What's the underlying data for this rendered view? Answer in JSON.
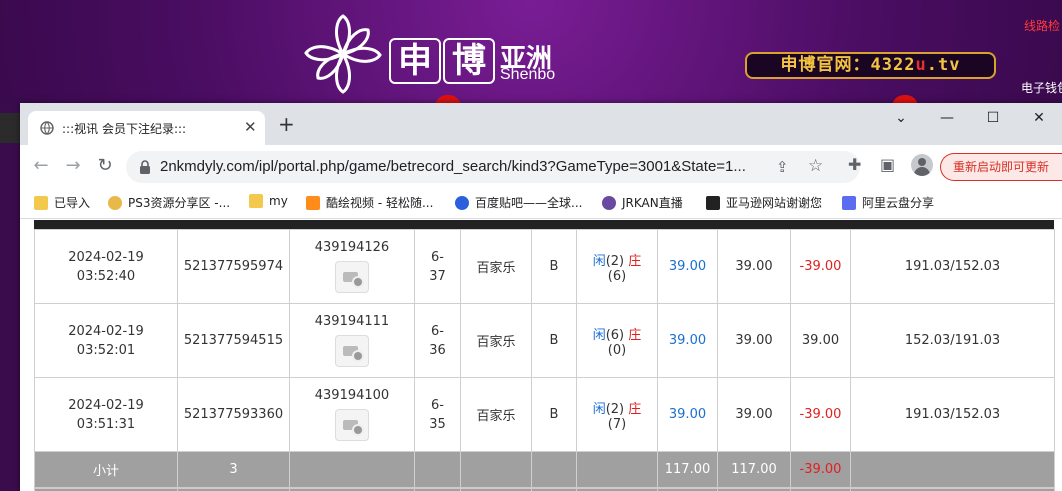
{
  "banner": {
    "logo_cn_1": "申",
    "logo_cn_2": "博",
    "logo_cn_3": "亚洲",
    "logo_en": "Shenbo",
    "site_url_prefix": "申博官网：4322",
    "site_url_u": "u",
    "site_url_suffix": ".tv",
    "line_check": "线路检",
    "e_wallet": "电子钱包"
  },
  "browser": {
    "tab_title": ":::视讯 会员下注纪录:::",
    "url": "2nkmdyly.com/ipl/portal.php/game/betrecord_search/kind3?GameType=3001&State=1...",
    "relaunch_label": "重新启动即可更新",
    "window_controls": {
      "minimize": "—",
      "maximize": "☐",
      "close": "✕",
      "more": "⌄"
    },
    "bookmarks": [
      {
        "label": "已导入",
        "icon": "folder-icon",
        "color": "#f2c94c"
      },
      {
        "label": "PS3资源分享区 -...",
        "icon": "ps3-icon",
        "color": "#e8b94a"
      },
      {
        "label": "my",
        "icon": "folder-icon",
        "color": "#f2c94c"
      },
      {
        "label": "酷绘视频 - 轻松随...",
        "icon": "video-icon",
        "color": "#ff8c1a"
      },
      {
        "label": "百度贴吧——全球...",
        "icon": "baidu-icon",
        "color": "#2b5fdc"
      },
      {
        "label": "JRKAN直播",
        "icon": "jrkan-icon",
        "color": "#6a4aa0"
      },
      {
        "label": "亚马逊网站谢谢您",
        "icon": "amazon-icon",
        "color": "#222222"
      },
      {
        "label": "阿里云盘分享",
        "icon": "aliyun-icon",
        "color": "#5b6cf0"
      }
    ]
  },
  "records": {
    "rows": [
      {
        "date": "2024-02-19",
        "time": "03:52:40",
        "order": "521377595974",
        "round": "439194126",
        "table_a": "6-",
        "table_b": "37",
        "game": "百家乐",
        "bet": "B",
        "player_label": "闲",
        "player_val": "(2)",
        "banker_label": "庄",
        "banker_val": "(6)",
        "amount": "39.00",
        "valid": "39.00",
        "winloss": "-39.00",
        "balance": "191.03/152.03",
        "winloss_negative": true
      },
      {
        "date": "2024-02-19",
        "time": "03:52:01",
        "order": "521377594515",
        "round": "439194111",
        "table_a": "6-",
        "table_b": "36",
        "game": "百家乐",
        "bet": "B",
        "player_label": "闲",
        "player_val": "(6)",
        "banker_label": "庄",
        "banker_val": "(0)",
        "amount": "39.00",
        "valid": "39.00",
        "winloss": "39.00",
        "balance": "152.03/191.03",
        "winloss_negative": false
      },
      {
        "date": "2024-02-19",
        "time": "03:51:31",
        "order": "521377593360",
        "round": "439194100",
        "table_a": "6-",
        "table_b": "35",
        "game": "百家乐",
        "bet": "B",
        "player_label": "闲",
        "player_val": "(2)",
        "banker_label": "庄",
        "banker_val": "(7)",
        "amount": "39.00",
        "valid": "39.00",
        "winloss": "-39.00",
        "balance": "191.03/152.03",
        "winloss_negative": true
      }
    ],
    "subtotal": {
      "label": "小计",
      "count": "3",
      "amount": "117.00",
      "valid": "117.00",
      "winloss": "-39.00"
    }
  }
}
